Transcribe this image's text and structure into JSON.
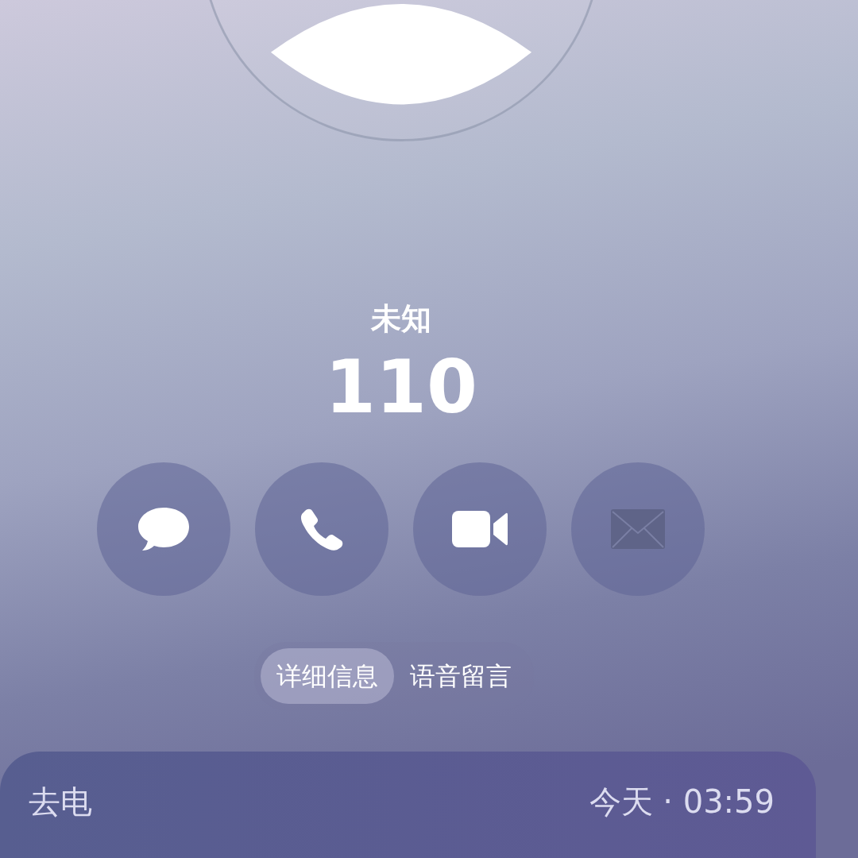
{
  "contact": {
    "name": "未知",
    "number": "110"
  },
  "actions": [
    {
      "kind": "message",
      "disabled": false
    },
    {
      "kind": "call",
      "disabled": false
    },
    {
      "kind": "video",
      "disabled": false
    },
    {
      "kind": "mail",
      "disabled": true
    }
  ],
  "tabs": [
    {
      "label": "详细信息",
      "selected": true
    },
    {
      "label": "语音留言",
      "selected": false
    }
  ],
  "call_log": {
    "type": "去电",
    "time": "今天 · 03:59"
  }
}
